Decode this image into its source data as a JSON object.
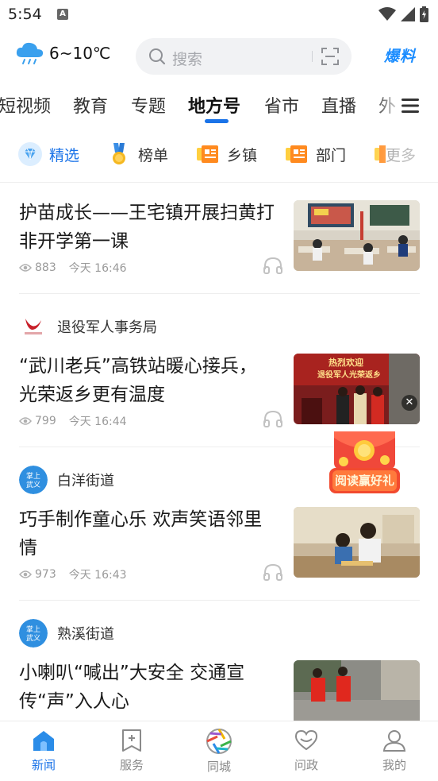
{
  "status_bar": {
    "time": "5:54",
    "notif_icon": "a-square-icon"
  },
  "header": {
    "weather_icon": "cloud-rain-icon",
    "temperature": "6~10℃",
    "search_placeholder": "搜索",
    "baoliao_label": "爆料"
  },
  "channels": [
    {
      "label": "短视频",
      "active": false
    },
    {
      "label": "教育",
      "active": false
    },
    {
      "label": "专题",
      "active": false
    },
    {
      "label": "地方号",
      "active": true
    },
    {
      "label": "省市",
      "active": false
    },
    {
      "label": "直播",
      "active": false
    },
    {
      "label": "外",
      "active": false
    }
  ],
  "sub_tabs": [
    {
      "label": "精选",
      "icon": "diamond-icon",
      "active": true
    },
    {
      "label": "榜单",
      "icon": "medal-icon",
      "active": false
    },
    {
      "label": "乡镇",
      "icon": "news-icon",
      "active": false
    },
    {
      "label": "部门",
      "icon": "news-icon",
      "active": false
    },
    {
      "label": "更多",
      "icon": "news-icon",
      "active": false
    }
  ],
  "articles": [
    {
      "source": "",
      "title_line1": "护苗成长——王宅镇开展扫黄打",
      "title_line2": "非开学第一课",
      "views": "883",
      "time": "今天 16:46"
    },
    {
      "source": "退役军人事务局",
      "title_line1": "“武川老兵”高铁站暖心接兵，",
      "title_line2": "光荣返乡更有温度",
      "views": "799",
      "time": "今天 16:44",
      "thumb_text1": "热烈欢迎",
      "thumb_text2": "退役军人光荣返乡"
    },
    {
      "source": "白洋街道",
      "title_line1": "巧手制作童心乐 欢声笑语邻里",
      "title_line2": "情",
      "views": "973",
      "time": "今天 16:43"
    },
    {
      "source": "熟溪街道",
      "title_line1": "小喇叭“喊出”大安全  交通宣",
      "title_line2": "传“声”入人心",
      "views": "",
      "time": ""
    }
  ],
  "avatar_text": {
    "line1": "掌上",
    "line2": "武义"
  },
  "float_ad": {
    "label": "阅读赢好礼"
  },
  "bottom_nav": [
    {
      "label": "新闻",
      "icon": "home-icon",
      "active": true
    },
    {
      "label": "服务",
      "icon": "bookmark-plus-icon",
      "active": false
    },
    {
      "label": "同城",
      "icon": "aperture-icon",
      "active": false
    },
    {
      "label": "问政",
      "icon": "heart-chat-icon",
      "active": false
    },
    {
      "label": "我的",
      "icon": "user-icon",
      "active": false
    }
  ],
  "colors": {
    "accent": "#1a73e8",
    "baoliao": "#1a8cff",
    "meta": "#9a9a9a"
  }
}
